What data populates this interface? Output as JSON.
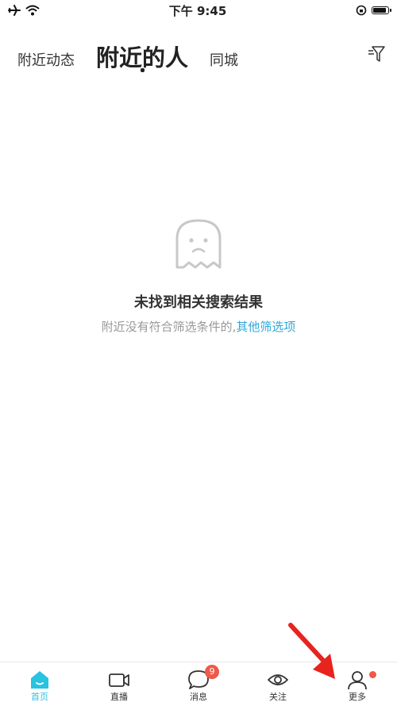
{
  "status_bar": {
    "time": "下午 9:45",
    "icons": [
      "airplane-icon",
      "wifi-icon",
      "rotation-lock-icon",
      "battery-icon"
    ]
  },
  "tabs": [
    {
      "label": "附近动态",
      "active": false
    },
    {
      "label": "附近的人",
      "active": true
    },
    {
      "label": "同城",
      "active": false
    }
  ],
  "filter": {
    "icon": "filter-icon"
  },
  "empty_state": {
    "icon": "ghost-icon",
    "title": "未找到相关搜索结果",
    "subtitle_prefix": "附近没有符合筛选条件的,",
    "subtitle_link": "其他筛选项"
  },
  "bottom_nav": [
    {
      "label": "首页",
      "icon": "home-icon",
      "active": true
    },
    {
      "label": "直播",
      "icon": "video-camera-icon",
      "active": false
    },
    {
      "label": "消息",
      "icon": "chat-bubble-icon",
      "badge": "9",
      "active": false
    },
    {
      "label": "关注",
      "icon": "eye-icon",
      "active": false
    },
    {
      "label": "更多",
      "icon": "user-icon",
      "dot": true,
      "active": false
    }
  ],
  "colors": {
    "accent": "#29c3e0",
    "link": "#2fa8d8",
    "badge": "#f0584a",
    "arrow": "#e8231e"
  }
}
